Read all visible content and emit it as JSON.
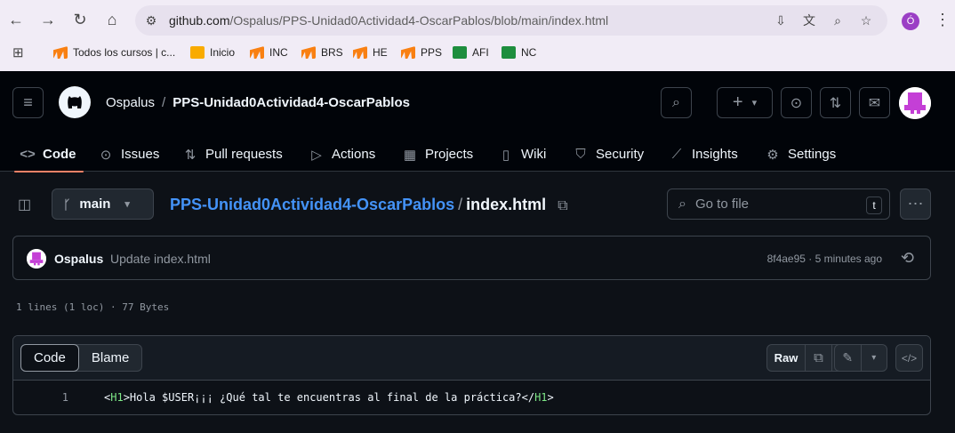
{
  "browser": {
    "url_host": "github.com",
    "url_path": "/Ospalus/PPS-Unidad0Actividad4-OscarPablos/blob/main/index.html",
    "profile_initial": "Ó",
    "bookmarks": [
      {
        "label": "Todos los cursos | c...",
        "icon": "moodle-icon"
      },
      {
        "label": "Inicio",
        "icon": "classroom-icon"
      },
      {
        "label": "INC",
        "icon": "moodle-icon"
      },
      {
        "label": "BRS",
        "icon": "moodle-icon"
      },
      {
        "label": "HE",
        "icon": "moodle-icon"
      },
      {
        "label": "PPS",
        "icon": "moodle-icon"
      },
      {
        "label": "AFI",
        "icon": "classroom-icon"
      },
      {
        "label": "NC",
        "icon": "classroom-icon"
      }
    ]
  },
  "header": {
    "owner": "Ospalus",
    "separator": "/",
    "repo": "PPS-Unidad0Actividad4-OscarPablos",
    "add_label": "+"
  },
  "tabs": [
    {
      "label": "Code",
      "icon": "code-icon"
    },
    {
      "label": "Issues",
      "icon": "issue-icon"
    },
    {
      "label": "Pull requests",
      "icon": "pull-request-icon"
    },
    {
      "label": "Actions",
      "icon": "play-icon"
    },
    {
      "label": "Projects",
      "icon": "table-icon"
    },
    {
      "label": "Wiki",
      "icon": "book-icon"
    },
    {
      "label": "Security",
      "icon": "shield-icon"
    },
    {
      "label": "Insights",
      "icon": "graph-icon"
    },
    {
      "label": "Settings",
      "icon": "gear-icon"
    }
  ],
  "file_nav": {
    "branch": "main",
    "path_repo": "PPS-Unidad0Actividad4-OscarPablos",
    "path_sep": "/",
    "path_file": "index.html",
    "goto_placeholder": "Go to file",
    "goto_shortcut": "t"
  },
  "commit": {
    "author": "Ospalus",
    "message": "Update index.html",
    "meta": "8f4ae95 · 5 minutes ago"
  },
  "file_info": "1 lines (1 loc) · 77 Bytes",
  "code_view": {
    "tab_code": "Code",
    "tab_blame": "Blame",
    "raw_label": "Raw",
    "lines": [
      {
        "num": "1",
        "open_tag": "<H1>",
        "text": "Hola $USER¡¡¡ ¿Qué tal te encuentras al final de la práctica?",
        "close_tag": "</H1>"
      }
    ]
  }
}
